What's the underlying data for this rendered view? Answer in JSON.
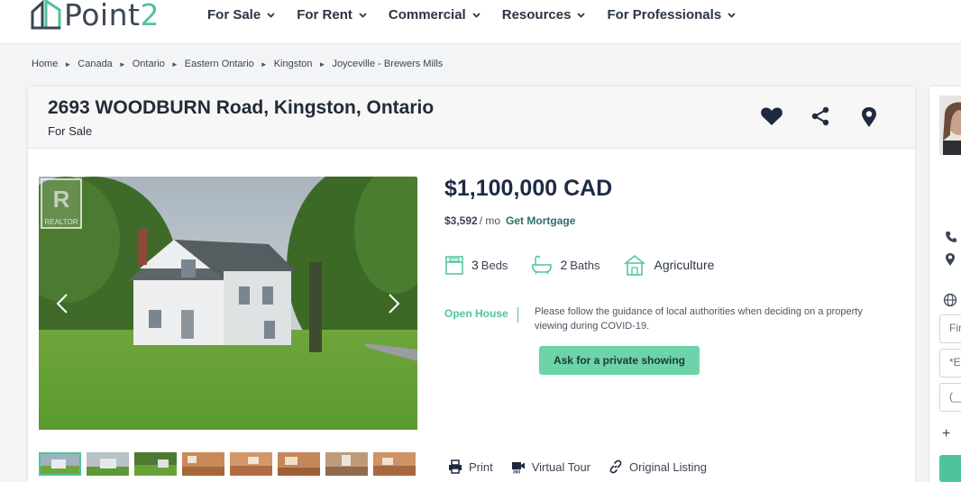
{
  "brand": {
    "logo_word": "Point",
    "logo_digit": "2",
    "accent": "#4fc39a"
  },
  "nav": {
    "items": [
      {
        "label": "For Sale"
      },
      {
        "label": "For Rent"
      },
      {
        "label": "Commercial"
      },
      {
        "label": "Resources"
      },
      {
        "label": "For Professionals"
      }
    ]
  },
  "breadcrumb": [
    "Home",
    "Canada",
    "Ontario",
    "Eastern Ontario",
    "Kingston",
    "Joyceville - Brewers Mills"
  ],
  "listing": {
    "address": "2693 WOODBURN Road, Kingston, Ontario",
    "status": "For Sale",
    "price": "$1,100,000 CAD",
    "monthly_amount": "$3,592",
    "monthly_unit": "/ mo",
    "mortgage_link": "Get Mortgage",
    "beds_count": "3",
    "beds_label": "Beds",
    "baths_count": "2",
    "baths_label": "Baths",
    "property_type": "Agriculture",
    "open_house_label": "Open House",
    "notice": "Please follow the guidance of local authorities when deciding on a property viewing during COVID-19.",
    "private_showing_button": "Ask for a private showing",
    "actions": {
      "print": "Print",
      "virtual_tour": "Virtual Tour",
      "original_listing": "Original Listing"
    },
    "photo_watermark": "REALTOR",
    "thumbnail_count": 8
  },
  "agent_panel": {
    "first_name_placeholder": "First",
    "email_placeholder": "*Email",
    "phone_placeholder": "(___"
  },
  "icons": {
    "nav_chevron": "chevron-down-icon",
    "favorite": "heart-icon",
    "share": "share-icon",
    "map": "map-pin-icon",
    "beds": "bed-icon",
    "baths": "bathtub-icon",
    "type": "house-icon",
    "print": "printer-icon",
    "tour": "video-camera-icon",
    "original": "link-icon",
    "phone": "phone-icon",
    "location": "location-icon",
    "language": "globe-icon"
  }
}
